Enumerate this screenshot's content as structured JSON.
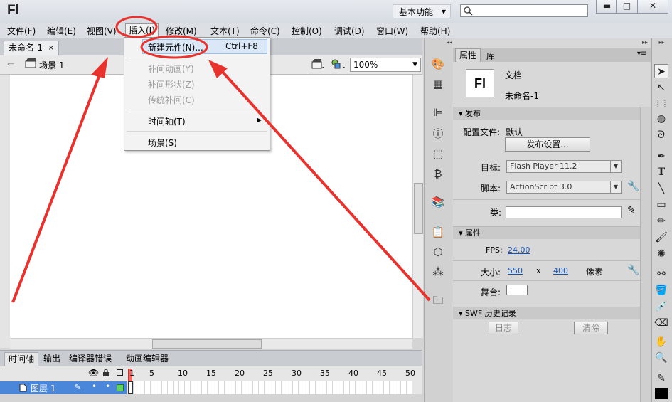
{
  "app": {
    "logo": "Fl"
  },
  "titlebar": {
    "workspace": "基本功能",
    "search_icon": "search-icon",
    "minimize": "▬",
    "maximize": "□",
    "close": "✕"
  },
  "menubar": {
    "items": [
      "文件(F)",
      "编辑(E)",
      "视图(V)",
      "插入(I)",
      "修改(M)",
      "文本(T)",
      "命令(C)",
      "控制(O)",
      "调试(D)",
      "窗口(W)",
      "帮助(H)"
    ]
  },
  "document": {
    "tab_label": "未命名-1",
    "tab_close": "×",
    "scene_label": "场景 1",
    "zoom": "100%"
  },
  "insert_menu": {
    "new_symbol": "新建元件(N)...",
    "new_symbol_shortcut": "Ctrl+F8",
    "motion_tween": "补间动画(Y)",
    "shape_tween": "补间形状(Z)",
    "classic_tween": "传统补间(C)",
    "timeline": "时间轴(T)",
    "scene": "场景(S)"
  },
  "timeline": {
    "tabs": [
      "时间轴",
      "输出",
      "编译器错误",
      "动画编辑器"
    ],
    "frame_numbers": [
      "1",
      "5",
      "10",
      "15",
      "20",
      "25",
      "30",
      "35",
      "40",
      "45",
      "50"
    ],
    "layer_name": "图层 1"
  },
  "properties": {
    "tabs": [
      "属性",
      "库"
    ],
    "doc_type": "文档",
    "doc_name": "未命名-1",
    "doc_icon_text": "Fl",
    "publish_section": "发布",
    "profile_label": "配置文件:",
    "profile_value": "默认",
    "publish_settings_btn": "发布设置...",
    "target_label": "目标:",
    "target_value": "Flash Player 11.2",
    "script_label": "脚本:",
    "script_value": "ActionScript 3.0",
    "class_label": "类:",
    "props_section": "属性",
    "fps_label": "FPS:",
    "fps_value": "24.00",
    "size_label": "大小:",
    "width_value": "550",
    "size_x": "x",
    "height_value": "400",
    "size_unit": "像素",
    "stage_label": "舞台:",
    "stage_color": "#ffffff",
    "swf_section": "SWF 历史记录",
    "log_btn": "日志",
    "clear_btn": "清除"
  },
  "colors": {
    "annotation_red": "#e8322e",
    "accent_blue": "#2a6bc8"
  }
}
